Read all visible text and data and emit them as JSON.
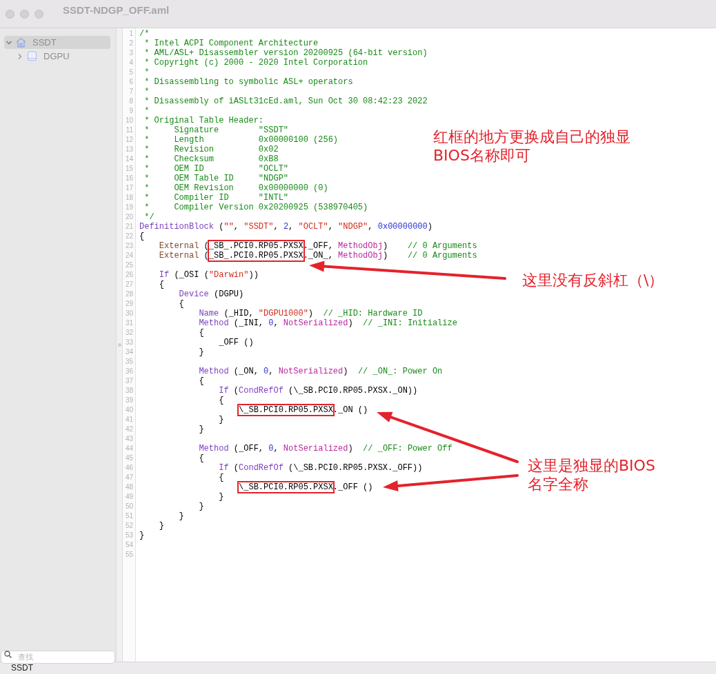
{
  "window": {
    "title": "SSDT-NDGP_OFF.aml"
  },
  "sidebar": {
    "items": [
      {
        "label": "SSDT",
        "kind": "root",
        "selected": true,
        "expanded": true,
        "children": [
          {
            "label": "DGPU",
            "kind": "device",
            "selected": false,
            "expanded": false
          }
        ]
      }
    ],
    "search": {
      "placeholder": "查找"
    }
  },
  "editor": {
    "lines": [
      {
        "num": "1",
        "tokens": [
          {
            "kind": "comment",
            "text": "/*"
          }
        ]
      },
      {
        "num": "2",
        "tokens": [
          {
            "kind": "comment",
            "text": " * Intel ACPI Component Architecture"
          }
        ]
      },
      {
        "num": "3",
        "tokens": [
          {
            "kind": "comment",
            "text": " * AML/ASL+ Disassembler version 20200925 (64-bit version)"
          }
        ]
      },
      {
        "num": "4",
        "tokens": [
          {
            "kind": "comment",
            "text": " * Copyright (c) 2000 - 2020 Intel Corporation"
          }
        ]
      },
      {
        "num": "5",
        "tokens": [
          {
            "kind": "comment",
            "text": " *"
          }
        ]
      },
      {
        "num": "6",
        "tokens": [
          {
            "kind": "comment",
            "text": " * Disassembling to symbolic ASL+ operators"
          }
        ]
      },
      {
        "num": "7",
        "tokens": [
          {
            "kind": "comment",
            "text": " *"
          }
        ]
      },
      {
        "num": "8",
        "tokens": [
          {
            "kind": "comment",
            "text": " * Disassembly of iASLt31cEd.aml, Sun Oct 30 08:42:23 2022"
          }
        ]
      },
      {
        "num": "9",
        "tokens": [
          {
            "kind": "comment",
            "text": " *"
          }
        ]
      },
      {
        "num": "10",
        "tokens": [
          {
            "kind": "comment",
            "text": " * Original Table Header:"
          }
        ]
      },
      {
        "num": "11",
        "tokens": [
          {
            "kind": "comment",
            "text": " *     Signature        \"SSDT\""
          }
        ]
      },
      {
        "num": "12",
        "tokens": [
          {
            "kind": "comment",
            "text": " *     Length           0x00000100 (256)"
          }
        ]
      },
      {
        "num": "13",
        "tokens": [
          {
            "kind": "comment",
            "text": " *     Revision         0x02"
          }
        ]
      },
      {
        "num": "14",
        "tokens": [
          {
            "kind": "comment",
            "text": " *     Checksum         0xB8"
          }
        ]
      },
      {
        "num": "15",
        "tokens": [
          {
            "kind": "comment",
            "text": " *     OEM ID           \"OCLT\""
          }
        ]
      },
      {
        "num": "16",
        "tokens": [
          {
            "kind": "comment",
            "text": " *     OEM Table ID     \"NDGP\""
          }
        ]
      },
      {
        "num": "17",
        "tokens": [
          {
            "kind": "comment",
            "text": " *     OEM Revision     0x00000000 (0)"
          }
        ]
      },
      {
        "num": "18",
        "tokens": [
          {
            "kind": "comment",
            "text": " *     Compiler ID      \"INTL\""
          }
        ]
      },
      {
        "num": "19",
        "tokens": [
          {
            "kind": "comment",
            "text": " *     Compiler Version 0x20200925 (538970405)"
          }
        ]
      },
      {
        "num": "20",
        "tokens": [
          {
            "kind": "comment",
            "text": " */"
          }
        ]
      },
      {
        "num": "21",
        "tokens": [
          {
            "kind": "keyword",
            "text": "DefinitionBlock"
          },
          {
            "kind": "plain",
            "text": " ("
          },
          {
            "kind": "string",
            "text": "\"\""
          },
          {
            "kind": "plain",
            "text": ", "
          },
          {
            "kind": "string",
            "text": "\"SSDT\""
          },
          {
            "kind": "plain",
            "text": ", "
          },
          {
            "kind": "number",
            "text": "2"
          },
          {
            "kind": "plain",
            "text": ", "
          },
          {
            "kind": "string",
            "text": "\"OCLT\""
          },
          {
            "kind": "plain",
            "text": ", "
          },
          {
            "kind": "string",
            "text": "\"NDGP\""
          },
          {
            "kind": "plain",
            "text": ", "
          },
          {
            "kind": "number",
            "text": "0x00000000"
          },
          {
            "kind": "plain",
            "text": ")"
          }
        ]
      },
      {
        "num": "22",
        "tokens": [
          {
            "kind": "plain",
            "text": "{"
          }
        ]
      },
      {
        "num": "23",
        "tokens": [
          {
            "kind": "external",
            "text": "    External"
          },
          {
            "kind": "plain",
            "text": " ("
          },
          {
            "kind": "boxed",
            "text": "_SB_.PCI0.RP05.PXSX"
          },
          {
            "kind": "plain",
            "text": "._OFF, "
          },
          {
            "kind": "objtype",
            "text": "MethodObj"
          },
          {
            "kind": "plain",
            "text": ")    "
          },
          {
            "kind": "comment",
            "text": "// 0 Arguments"
          }
        ]
      },
      {
        "num": "24",
        "tokens": [
          {
            "kind": "external",
            "text": "    External"
          },
          {
            "kind": "plain",
            "text": " ("
          },
          {
            "kind": "boxed",
            "text": "_SB_.PCI0.RP05.PXSX"
          },
          {
            "kind": "plain",
            "text": "._ON_, "
          },
          {
            "kind": "objtype",
            "text": "MethodObj"
          },
          {
            "kind": "plain",
            "text": ")    "
          },
          {
            "kind": "comment",
            "text": "// 0 Arguments"
          }
        ]
      },
      {
        "num": "25"
      },
      {
        "num": "26",
        "tokens": [
          {
            "kind": "keyword",
            "text": "    If"
          },
          {
            "kind": "plain",
            "text": " (_OSI ("
          },
          {
            "kind": "string",
            "text": "\"Darwin\""
          },
          {
            "kind": "plain",
            "text": "))"
          }
        ]
      },
      {
        "num": "27",
        "tokens": [
          {
            "kind": "plain",
            "text": "    {"
          }
        ]
      },
      {
        "num": "28",
        "tokens": [
          {
            "kind": "keyword",
            "text": "        Device"
          },
          {
            "kind": "plain",
            "text": " (DGPU)"
          }
        ]
      },
      {
        "num": "29",
        "tokens": [
          {
            "kind": "plain",
            "text": "        {"
          }
        ]
      },
      {
        "num": "30",
        "tokens": [
          {
            "kind": "keyword",
            "text": "            Name"
          },
          {
            "kind": "plain",
            "text": " (_HID, "
          },
          {
            "kind": "string",
            "text": "\"DGPU1000\""
          },
          {
            "kind": "plain",
            "text": ")  "
          },
          {
            "kind": "comment",
            "text": "// _HID: Hardware ID"
          }
        ]
      },
      {
        "num": "31",
        "tokens": [
          {
            "kind": "keyword",
            "text": "            Method"
          },
          {
            "kind": "plain",
            "text": " (_INI, "
          },
          {
            "kind": "number",
            "text": "0"
          },
          {
            "kind": "plain",
            "text": ", "
          },
          {
            "kind": "objtype",
            "text": "NotSerialized"
          },
          {
            "kind": "plain",
            "text": ")  "
          },
          {
            "kind": "comment",
            "text": "// _INI: Initialize"
          }
        ]
      },
      {
        "num": "32",
        "tokens": [
          {
            "kind": "plain",
            "text": "            {"
          }
        ]
      },
      {
        "num": "33",
        "tokens": [
          {
            "kind": "plain",
            "text": "                _OFF ()"
          }
        ]
      },
      {
        "num": "34",
        "tokens": [
          {
            "kind": "plain",
            "text": "            }"
          }
        ]
      },
      {
        "num": "35"
      },
      {
        "num": "36",
        "tokens": [
          {
            "kind": "keyword",
            "text": "            Method"
          },
          {
            "kind": "plain",
            "text": " (_ON, "
          },
          {
            "kind": "number",
            "text": "0"
          },
          {
            "kind": "plain",
            "text": ", "
          },
          {
            "kind": "objtype",
            "text": "NotSerialized"
          },
          {
            "kind": "plain",
            "text": ")  "
          },
          {
            "kind": "comment",
            "text": "// _ON_: Power On"
          }
        ]
      },
      {
        "num": "37",
        "tokens": [
          {
            "kind": "plain",
            "text": "            {"
          }
        ]
      },
      {
        "num": "38",
        "tokens": [
          {
            "kind": "keyword",
            "text": "                If"
          },
          {
            "kind": "plain",
            "text": " ("
          },
          {
            "kind": "keyword",
            "text": "CondRefOf"
          },
          {
            "kind": "plain",
            "text": " (\\_SB.PCI0.RP05.PXSX._ON))"
          }
        ]
      },
      {
        "num": "39",
        "tokens": [
          {
            "kind": "plain",
            "text": "                {"
          }
        ]
      },
      {
        "num": "40",
        "tokens": [
          {
            "kind": "boxed",
            "text": "                    \\_SB.PCI0.RP05.PXSX"
          },
          {
            "kind": "plain",
            "text": "._ON ()"
          }
        ]
      },
      {
        "num": "41",
        "tokens": [
          {
            "kind": "plain",
            "text": "                }"
          }
        ]
      },
      {
        "num": "42",
        "tokens": [
          {
            "kind": "plain",
            "text": "            }"
          }
        ]
      },
      {
        "num": "43"
      },
      {
        "num": "44",
        "tokens": [
          {
            "kind": "keyword",
            "text": "            Method"
          },
          {
            "kind": "plain",
            "text": " (_OFF, "
          },
          {
            "kind": "number",
            "text": "0"
          },
          {
            "kind": "plain",
            "text": ", "
          },
          {
            "kind": "objtype",
            "text": "NotSerialized"
          },
          {
            "kind": "plain",
            "text": ")  "
          },
          {
            "kind": "comment",
            "text": "// _OFF: Power Off"
          }
        ]
      },
      {
        "num": "45",
        "tokens": [
          {
            "kind": "plain",
            "text": "            {"
          }
        ]
      },
      {
        "num": "46",
        "tokens": [
          {
            "kind": "keyword",
            "text": "                If"
          },
          {
            "kind": "plain",
            "text": " ("
          },
          {
            "kind": "keyword",
            "text": "CondRefOf"
          },
          {
            "kind": "plain",
            "text": " (\\_SB.PCI0.RP05.PXSX._OFF))"
          }
        ]
      },
      {
        "num": "47",
        "tokens": [
          {
            "kind": "plain",
            "text": "                {"
          }
        ]
      },
      {
        "num": "48",
        "tokens": [
          {
            "kind": "boxed",
            "text": "                    \\_SB.PCI0.RP05.PXSX"
          },
          {
            "kind": "plain",
            "text": "._OFF ()"
          }
        ]
      },
      {
        "num": "49",
        "tokens": [
          {
            "kind": "plain",
            "text": "                }"
          }
        ]
      },
      {
        "num": "50",
        "tokens": [
          {
            "kind": "plain",
            "text": "            }"
          }
        ]
      },
      {
        "num": "51",
        "tokens": [
          {
            "kind": "plain",
            "text": "        }"
          }
        ]
      },
      {
        "num": "52",
        "tokens": [
          {
            "kind": "plain",
            "text": "    }"
          }
        ]
      },
      {
        "num": "53",
        "tokens": [
          {
            "kind": "plain",
            "text": "}"
          }
        ]
      },
      {
        "num": "54"
      },
      {
        "num": "55"
      }
    ]
  },
  "annotations": [
    {
      "text": "红框的地方更换成自己的独显BIOS名称即可"
    },
    {
      "text": "这里没有反斜杠（\\）"
    },
    {
      "text": "这里是独显的BIOS名字全称"
    }
  ],
  "status_bar": {
    "text": "SSDT"
  }
}
